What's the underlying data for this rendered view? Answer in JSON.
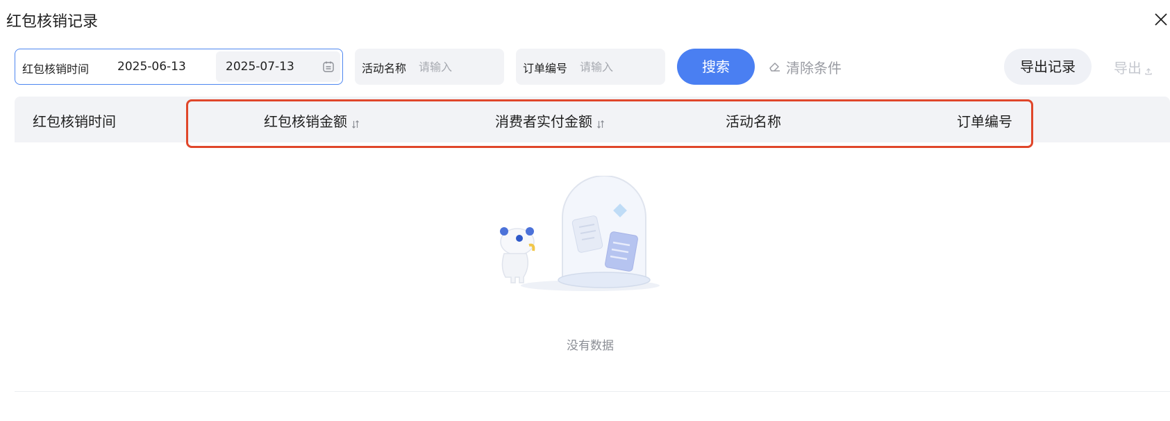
{
  "dialog": {
    "title": "红包核销记录",
    "close_icon": "close-icon"
  },
  "filters": {
    "date_range": {
      "label": "红包核销时间",
      "start": "2025-06-13",
      "end": "2025-07-13",
      "icon": "calendar-icon"
    },
    "activity_name": {
      "label": "活动名称",
      "placeholder": "请输入",
      "value": ""
    },
    "order_number": {
      "label": "订单编号",
      "placeholder": "请输入",
      "value": ""
    },
    "search_label": "搜索",
    "clear_label": "清除条件",
    "clear_icon": "eraser-icon",
    "export_record_label": "导出记录",
    "export_label": "导出",
    "export_icon": "upload-icon"
  },
  "table": {
    "columns": [
      {
        "label": "红包核销时间",
        "sortable": false
      },
      {
        "label": "红包核销金额",
        "sortable": true
      },
      {
        "label": "消费者实付金额",
        "sortable": true
      },
      {
        "label": "活动名称",
        "sortable": false
      },
      {
        "label": "订单编号",
        "sortable": false
      }
    ],
    "rows": [],
    "empty_text": "没有数据",
    "empty_icon": "empty-state-illustration"
  },
  "colors": {
    "primary": "#4a7ff2",
    "highlight": "#e0462a",
    "header_bg": "#f2f3f6",
    "muted_text": "#9a9ca3"
  }
}
